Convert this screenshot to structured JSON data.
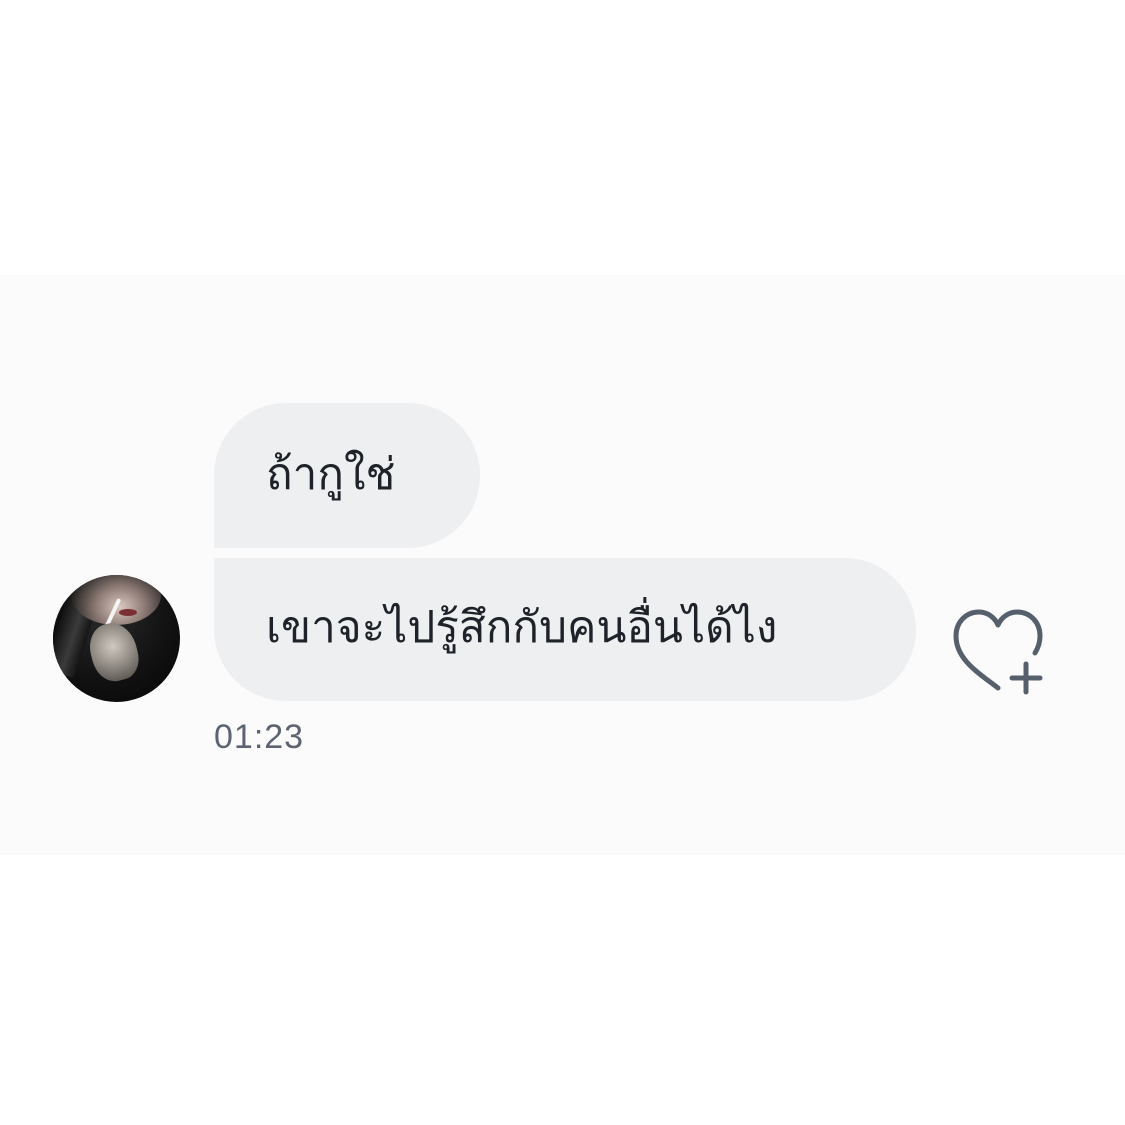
{
  "messages": [
    {
      "text": "ถ้ากูใช่"
    },
    {
      "text": "เขาจะไปรู้สึกกับคนอื่นได้ไง"
    }
  ],
  "timestamp": "01:23",
  "icons": {
    "react": "heart-plus-icon",
    "avatar": "avatar"
  },
  "colors": {
    "bubble": "#eeeff1",
    "text": "#1e232a",
    "meta": "#5c6471",
    "icon": "#56606d"
  }
}
